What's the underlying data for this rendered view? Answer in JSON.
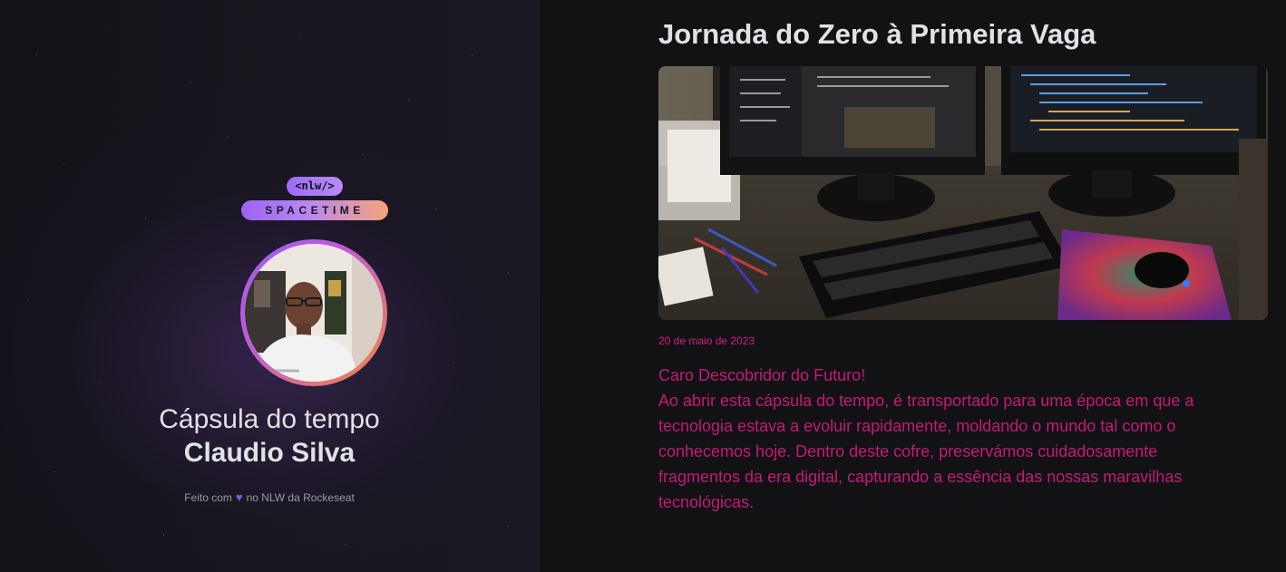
{
  "sidebar": {
    "logo_tag": "<nlw/>",
    "logo_text": "SPACETIME",
    "capsule_title": "Cápsula do tempo",
    "user_name": "Claudio Silva",
    "footer_before": "Feito com",
    "footer_after": "no NLW da Rockeseat",
    "footer_icon": "heart-icon"
  },
  "memory": {
    "title": "Jornada do Zero à Primeira Vaga",
    "date": "20 de maio de 2023",
    "content": "Caro Descobridor do Futuro!\nAo abrir esta cápsula do tempo, é transportado para uma época em que a tecnologia estava a evoluir rapidamente, moldando o mundo tal como o conhecemos hoje. Dentro deste cofre, preservámos cuidadosamente fragmentos da era digital, capturando a essência das nossas maravilhas tecnológicas."
  },
  "colors": {
    "background": "#121214",
    "text": "#e1e1e6",
    "accent_purple": "#8257e5",
    "content_pink": "#c4197a"
  }
}
